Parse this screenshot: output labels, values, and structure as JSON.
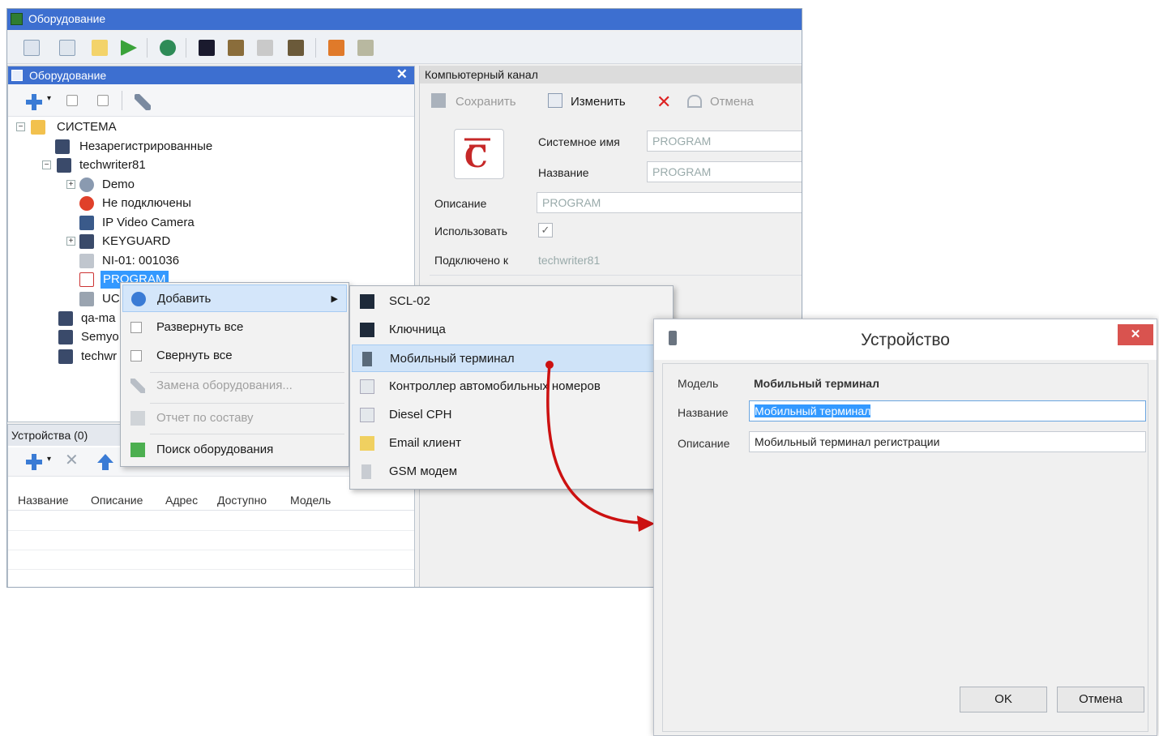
{
  "main_window": {
    "title": "Оборудование"
  },
  "tree_panel": {
    "title": "Оборудование",
    "close": "✕",
    "items": [
      {
        "label": "СИСТЕМА"
      },
      {
        "label": "Незарегистрированные"
      },
      {
        "label": "techwriter81"
      },
      {
        "label": "Demo"
      },
      {
        "label": "Не подключены"
      },
      {
        "label": "IP Video Camera"
      },
      {
        "label": "KEYGUARD"
      },
      {
        "label": "NI-01: 001036"
      },
      {
        "label": "PROGRAM"
      },
      {
        "label": "UC"
      },
      {
        "label": "qa-ma"
      },
      {
        "label": "Semyo"
      },
      {
        "label": "techwr"
      }
    ]
  },
  "devices_panel": {
    "title": "Устройства (0)",
    "columns": [
      "Название",
      "Описание",
      "Адрес",
      "Доступно",
      "Модель"
    ]
  },
  "details_panel": {
    "title": "Компьютерный канал",
    "toolbar": {
      "save": "Сохранить",
      "edit": "Изменить",
      "cancel": "Отмена"
    },
    "fields": {
      "system_name_label": "Системное имя",
      "system_name_value": "PROGRAM",
      "name_label": "Название",
      "name_value": "PROGRAM",
      "description_label": "Описание",
      "description_value": "PROGRAM",
      "use_label": "Использовать",
      "use_checked": true,
      "connected_label": "Подключено к",
      "connected_value": "techwriter81"
    }
  },
  "context_menu": {
    "items": [
      {
        "label": "Добавить",
        "submenu": true,
        "disabled": false
      },
      {
        "label": "Развернуть все",
        "disabled": false
      },
      {
        "label": "Свернуть все",
        "disabled": false
      },
      {
        "label": "Замена оборудования...",
        "disabled": true
      },
      {
        "label": "Отчет по составу",
        "disabled": true
      },
      {
        "label": "Поиск оборудования",
        "disabled": false
      }
    ]
  },
  "submenu": {
    "items": [
      {
        "label": "SCL-02"
      },
      {
        "label": "Ключница"
      },
      {
        "label": "Мобильный терминал"
      },
      {
        "label": "Контроллер автомобильных номеров"
      },
      {
        "label": "Diesel CPH"
      },
      {
        "label": "Email клиент"
      },
      {
        "label": "GSM модем"
      }
    ]
  },
  "dialog": {
    "title": "Устройство",
    "close": "✕",
    "model_label": "Модель",
    "model_value": "Мобильный терминал",
    "name_label": "Название",
    "name_value": "Мобильный терминал",
    "description_label": "Описание",
    "description_value": "Мобильный терминал регистрации",
    "ok": "OK",
    "cancel": "Отмена"
  },
  "colors": {
    "title_bar": "#3d6fd0",
    "selection": "#3399ff",
    "arrow": "#cc1111",
    "close_button": "#d9534f"
  }
}
